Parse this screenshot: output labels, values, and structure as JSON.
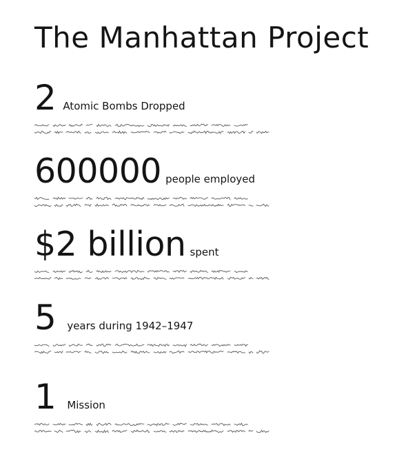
{
  "title": "The Manhattan Project",
  "stats": [
    {
      "value": "2",
      "label": "Atomic Bombs Dropped"
    },
    {
      "value": "600000",
      "label": "people employed"
    },
    {
      "value": "$2 billion",
      "label": "spent"
    },
    {
      "value": "5",
      "label": "years during 1942–1947"
    },
    {
      "value": "1",
      "label": "Mission"
    }
  ]
}
